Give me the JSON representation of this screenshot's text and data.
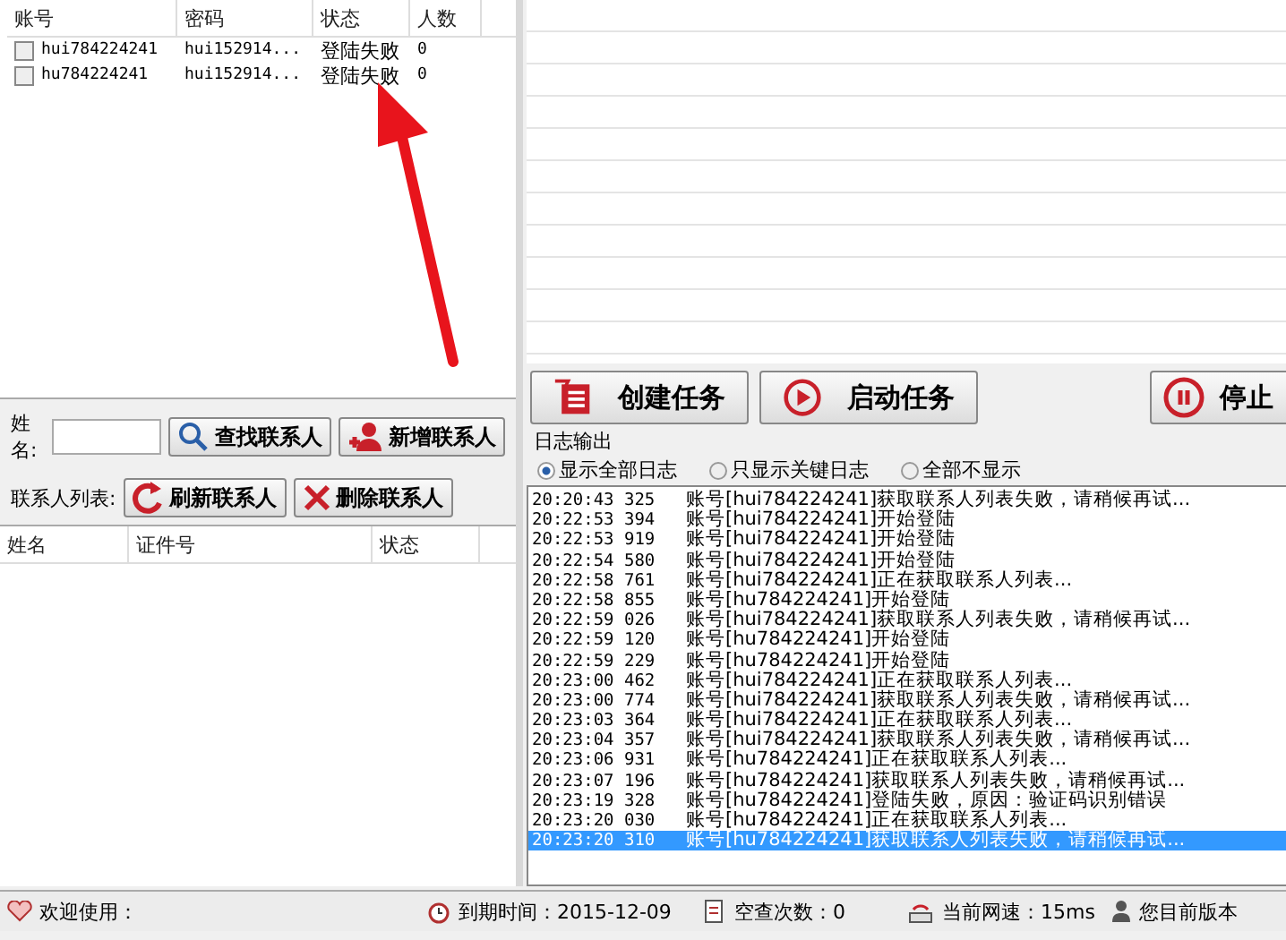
{
  "accounts": {
    "columns": [
      "账号",
      "密码",
      "状态",
      "人数"
    ],
    "rows": [
      {
        "checked": false,
        "account": "hui784224241",
        "password": "hui152914...",
        "status": "登陆失败",
        "count": "0"
      },
      {
        "checked": false,
        "account": "hu784224241",
        "password": "hui152914...",
        "status": "登陆失败",
        "count": "0"
      }
    ]
  },
  "contact_search": {
    "label": "姓名:",
    "buttons": [
      {
        "label": "查找联系人"
      },
      {
        "label": "新增联系人"
      }
    ]
  },
  "contact_list": {
    "label": "联系人列表:",
    "buttons": [
      {
        "label": "刷新联系人"
      },
      {
        "label": "删除联系人"
      }
    ],
    "columns": [
      "姓名",
      "证件号",
      "状态"
    ]
  },
  "task_buttons": [
    {
      "label": "创建任务"
    },
    {
      "label": "启动任务"
    },
    {
      "label": "停止"
    }
  ],
  "log": {
    "title": "日志输出",
    "filters": [
      {
        "label": "显示全部日志",
        "selected": true
      },
      {
        "label": "只显示关键日志",
        "selected": false
      },
      {
        "label": "全部不显示",
        "selected": false
      }
    ],
    "entries": [
      {
        "time": "20:20:43 325",
        "message": "账号[hui784224241]获取联系人列表失败，请稍候再试...",
        "selected": false
      },
      {
        "time": "20:22:53 394",
        "message": "账号[hui784224241]开始登陆",
        "selected": false
      },
      {
        "time": "20:22:53 919",
        "message": "账号[hui784224241]开始登陆",
        "selected": false
      },
      {
        "time": "20:22:54 580",
        "message": "账号[hui784224241]开始登陆",
        "selected": false
      },
      {
        "time": "20:22:58 761",
        "message": "账号[hui784224241]正在获取联系人列表...",
        "selected": false
      },
      {
        "time": "20:22:58 855",
        "message": "账号[hu784224241]开始登陆",
        "selected": false
      },
      {
        "time": "20:22:59 026",
        "message": "账号[hui784224241]获取联系人列表失败，请稍候再试...",
        "selected": false
      },
      {
        "time": "20:22:59 120",
        "message": "账号[hu784224241]开始登陆",
        "selected": false
      },
      {
        "time": "20:22:59 229",
        "message": "账号[hu784224241]开始登陆",
        "selected": false
      },
      {
        "time": "20:23:00 462",
        "message": "账号[hui784224241]正在获取联系人列表...",
        "selected": false
      },
      {
        "time": "20:23:00 774",
        "message": "账号[hui784224241]获取联系人列表失败，请稍候再试...",
        "selected": false
      },
      {
        "time": "20:23:03 364",
        "message": "账号[hui784224241]正在获取联系人列表...",
        "selected": false
      },
      {
        "time": "20:23:04 357",
        "message": "账号[hui784224241]获取联系人列表失败，请稍候再试...",
        "selected": false
      },
      {
        "time": "20:23:06 931",
        "message": "账号[hu784224241]正在获取联系人列表...",
        "selected": false
      },
      {
        "time": "20:23:07 196",
        "message": "账号[hu784224241]获取联系人列表失败，请稍候再试...",
        "selected": false
      },
      {
        "time": "20:23:19 328",
        "message": "账号[hu784224241]登陆失败，原因：验证码识别错误",
        "selected": false
      },
      {
        "time": "20:23:20 030",
        "message": "账号[hu784224241]正在获取联系人列表...",
        "selected": false
      },
      {
        "time": "20:23:20 310",
        "message": "账号[hu784224241]获取联系人列表失败，请稍候再试...",
        "selected": true
      }
    ]
  },
  "status_bar": [
    {
      "text": "欢迎使用："
    },
    {
      "text": "到期时间：2015-12-09"
    },
    {
      "text": "空查次数：0"
    },
    {
      "text": "当前网速：15ms"
    },
    {
      "text": "您目前版本"
    }
  ]
}
